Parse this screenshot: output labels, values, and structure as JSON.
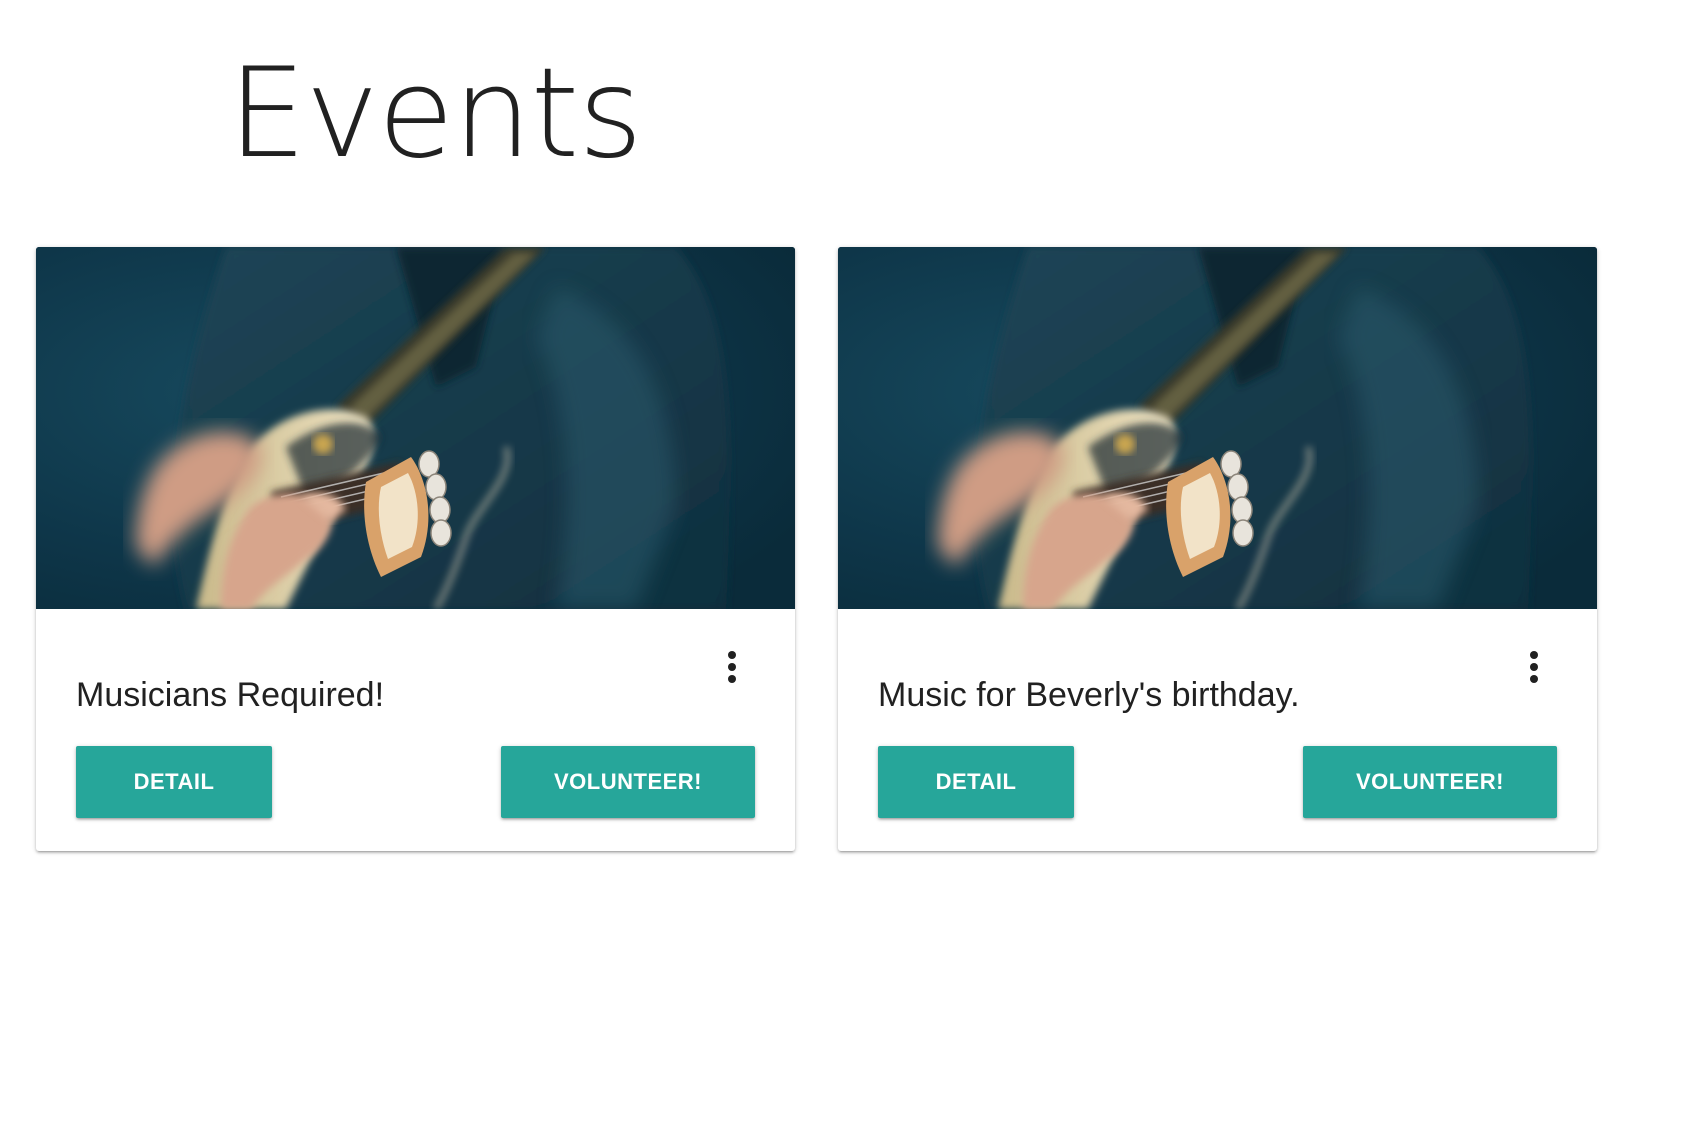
{
  "page": {
    "title": "Events"
  },
  "theme": {
    "accent": "#26a69a",
    "text": "#212121",
    "image_background": "#0d3346"
  },
  "events": [
    {
      "title": "Musicians Required!",
      "image": "guitarist-photo",
      "menu_icon": "more-vert-icon",
      "detail_label": "DETAIL",
      "volunteer_label": "VOLUNTEER!"
    },
    {
      "title": "Music for Beverly's birthday.",
      "image": "guitarist-photo",
      "menu_icon": "more-vert-icon",
      "detail_label": "DETAIL",
      "volunteer_label": "VOLUNTEER!"
    }
  ]
}
